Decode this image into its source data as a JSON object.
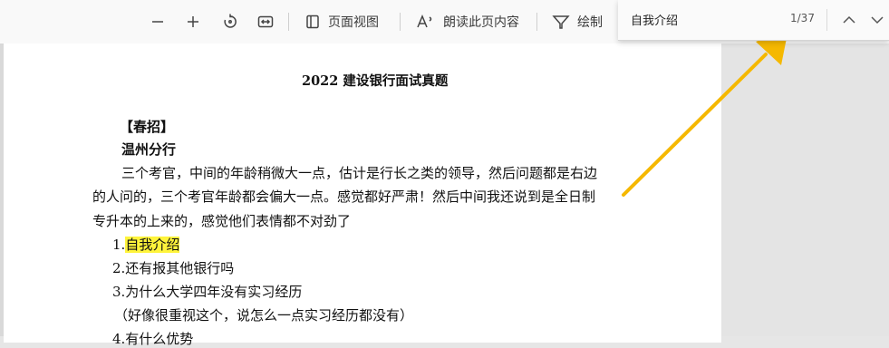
{
  "toolbar": {
    "page_view_label": "页面视图",
    "read_aloud_label": "朗读此页内容",
    "draw_label": "绘制"
  },
  "find": {
    "query": "自我介绍",
    "count": "1/37"
  },
  "document": {
    "title": "2022 建设银行面试真题",
    "section": "【春招】",
    "branch": "温州分行",
    "para_lines": [
      "三个考官，中间的年龄稍微大一点，估计是行长之类的领导，然后问题都是右边",
      "的人问的，三个考官年龄都会偏大一点。感觉都好严肃！然后中间我还说到是全日制",
      "专升本的上来的，感觉他们表情都不对劲了"
    ],
    "q1_num": "1.",
    "q1_text": "自我介绍",
    "q2": "2.还有报其他银行吗",
    "q3": "3.为什么大学四年没有实习经历",
    "q3_note": "（好像很重视这个，说怎么一点实习经历都没有）",
    "q4": "4.有什么优势"
  },
  "colors": {
    "highlight": "#fff43b",
    "arrow": "#f5b800"
  }
}
